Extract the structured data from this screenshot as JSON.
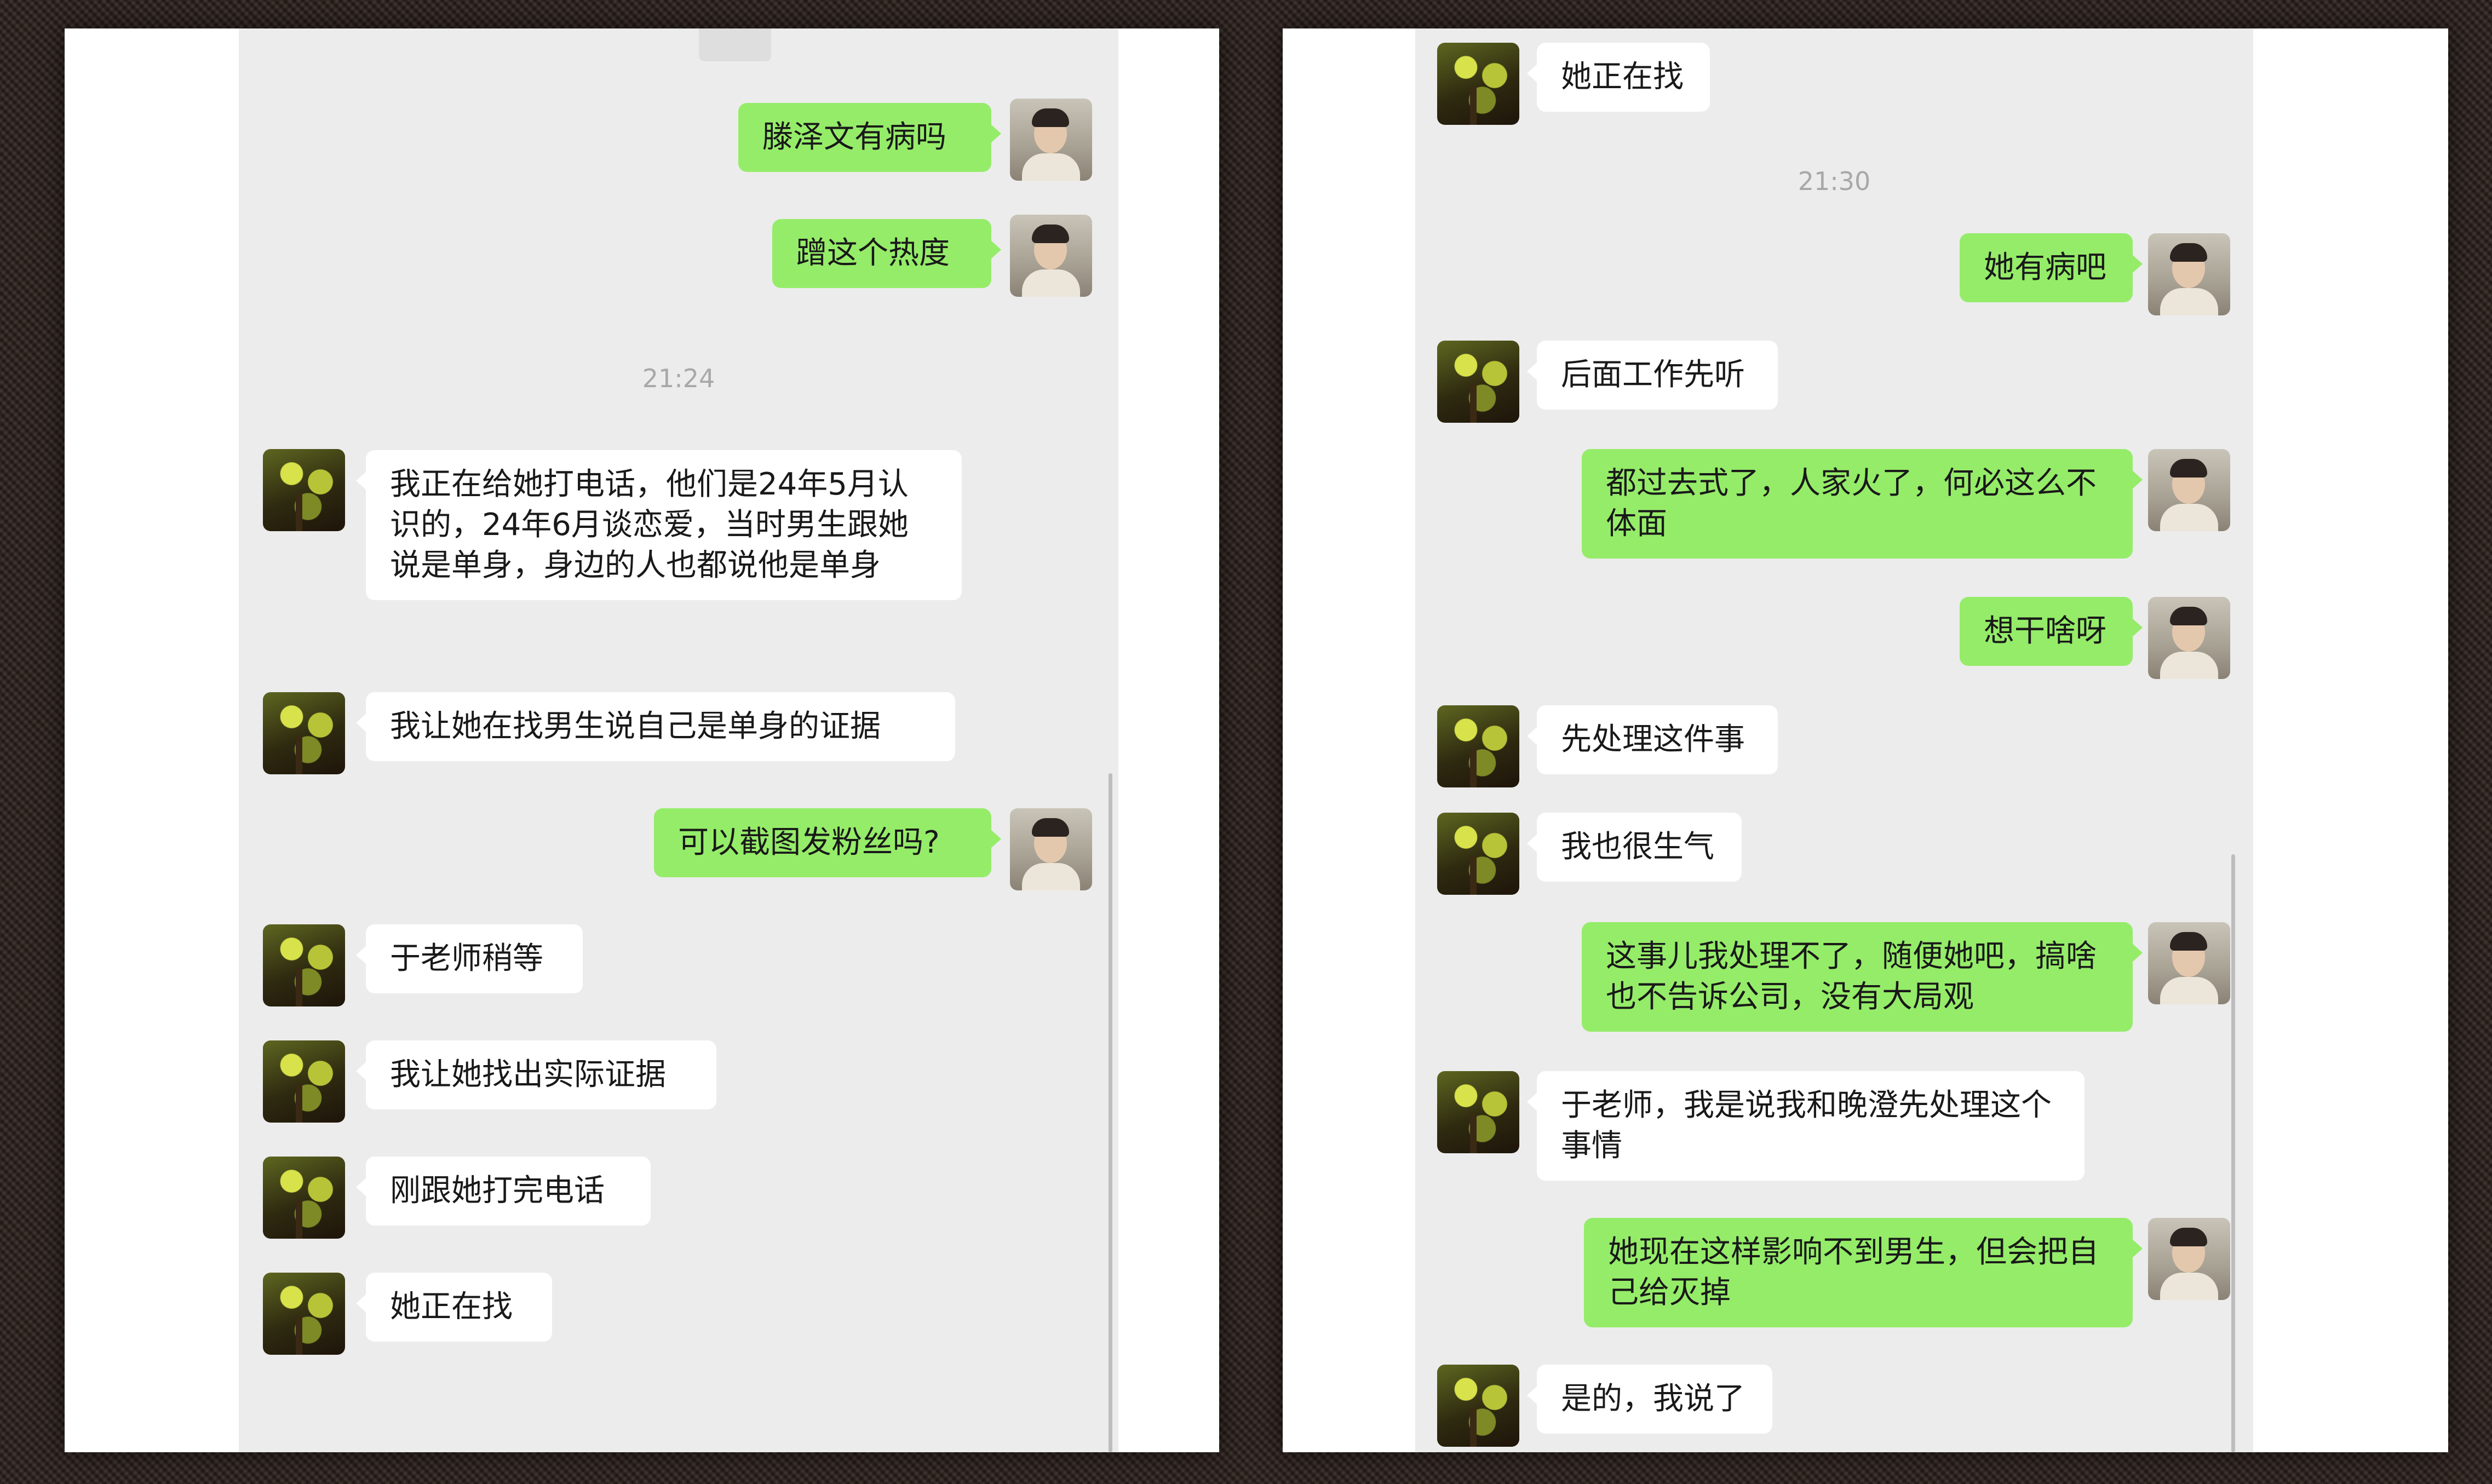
{
  "left_panel": {
    "messages": [
      {
        "sender": "me",
        "text": "滕泽文有病吗"
      },
      {
        "sender": "me",
        "text": "蹭这个热度"
      },
      {
        "time": "21:24"
      },
      {
        "sender": "other",
        "text": "我正在给她打电话，他们是24年5月认识的，24年6月谈恋爱，当时男生跟她说是单身，身边的人也都说他是单身"
      },
      {
        "sender": "other",
        "text": "我让她在找男生说自己是单身的证据"
      },
      {
        "sender": "me",
        "text": "可以截图发粉丝吗?"
      },
      {
        "sender": "other",
        "text": "于老师稍等"
      },
      {
        "sender": "other",
        "text": "我让她找出实际证据"
      },
      {
        "sender": "other",
        "text": "刚跟她打完电话"
      },
      {
        "sender": "other",
        "text": "她正在找"
      }
    ]
  },
  "right_panel": {
    "messages": [
      {
        "sender": "other",
        "text": "她正在找"
      },
      {
        "time": "21:30"
      },
      {
        "sender": "me",
        "text": "她有病吧"
      },
      {
        "sender": "other",
        "text": "后面工作先听"
      },
      {
        "sender": "me",
        "text": "都过去式了，人家火了，何必这么不体面"
      },
      {
        "sender": "me",
        "text": "想干啥呀"
      },
      {
        "sender": "other",
        "text": "先处理这件事"
      },
      {
        "sender": "other",
        "text": "我也很生气"
      },
      {
        "sender": "me",
        "text": "这事儿我处理不了，随便她吧，搞啥也不告诉公司，没有大局观"
      },
      {
        "sender": "other",
        "text": "于老师，我是说我和晚澄先处理这个事情"
      },
      {
        "sender": "me",
        "text": "她现在这样影响不到男生，但会把自己给灭掉"
      },
      {
        "sender": "other",
        "text": "是的，我说了"
      }
    ]
  },
  "colors": {
    "my_bubble": "#95ec69",
    "other_bubble": "#ffffff",
    "chat_background": "#ececec",
    "timestamp": "#a8a8a8"
  },
  "icons": {
    "other_avatar": "night-tree-photo",
    "my_avatar": "man-portrait-photo"
  }
}
